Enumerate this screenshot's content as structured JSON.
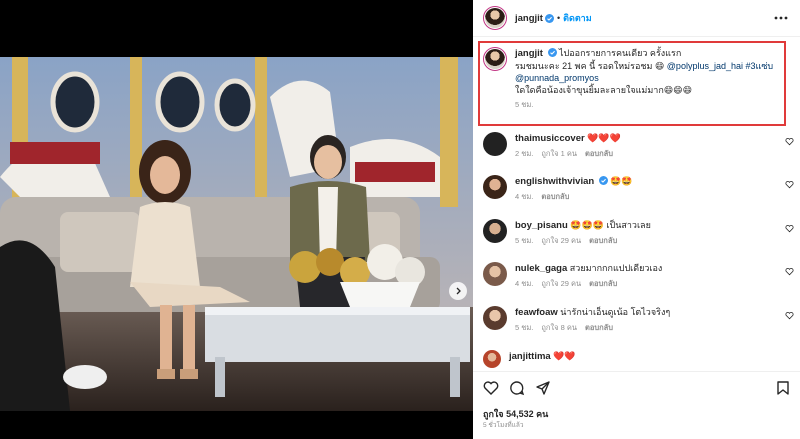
{
  "post": {
    "author": "jangjit",
    "follow_label": "ติดตาม",
    "separator": "•"
  },
  "caption": {
    "username": "jangjit",
    "line1": "ไปออกรายการคนเดียว ครั้งแรก",
    "line2_prefix": "รมชมนะคะ 21 พค นี้ รอดใหม่รอชม 😄",
    "mention1": "@polyplus_jad_hai",
    "hashtag": "#3แซ่บ",
    "mention2": "@punnada_promyos",
    "line3": "ใดใดคือน้องเจ้าขุนยิ้มละลายใจแม่มาก😄😄😄",
    "time": "5 ชม."
  },
  "comments": [
    {
      "username": "thaimusiccover",
      "text": "❤️❤️❤️",
      "time": "2 ชม.",
      "likes": "ถูกใจ 1 คน",
      "reply": "ตอบกลับ"
    },
    {
      "username": "englishwithvivian",
      "text": "🤩🤩",
      "time": "4 ชม.",
      "likes": "",
      "reply": "ตอบกลับ"
    },
    {
      "username": "boy_pisanu",
      "text": "🤩🤩🤩 เป็นสาวเลย",
      "time": "5 ชม.",
      "likes": "ถูกใจ 29 คน",
      "reply": "ตอบกลับ"
    },
    {
      "username": "nulek_gaga",
      "text": "สวยมากกกแปปเดียวเอง",
      "time": "4 ชม.",
      "likes": "ถูกใจ 29 คน",
      "reply": "ตอบกลับ"
    },
    {
      "username": "feawfoaw",
      "text": "น่ารักน่าเอ็นดูเน้อ โตไวจริงๆ",
      "time": "5 ชม.",
      "likes": "ถูกใจ 8 คน",
      "reply": "ตอบกลับ"
    },
    {
      "username": "janjittima",
      "text": "❤️❤️",
      "time": "",
      "likes": "",
      "reply": ""
    }
  ],
  "footer": {
    "likes": "ถูกใจ 54,532 คน",
    "posted": "5 ชั่วโมงที่แล้ว"
  },
  "colors": {
    "link": "#00376b",
    "follow": "#0095f6",
    "highlight": "#e03a3a",
    "verified": "#3897f0"
  },
  "icons": [
    "heart-icon",
    "comment-icon",
    "share-icon",
    "bookmark-icon",
    "more-icon",
    "verified-icon",
    "chevron-right-icon"
  ]
}
